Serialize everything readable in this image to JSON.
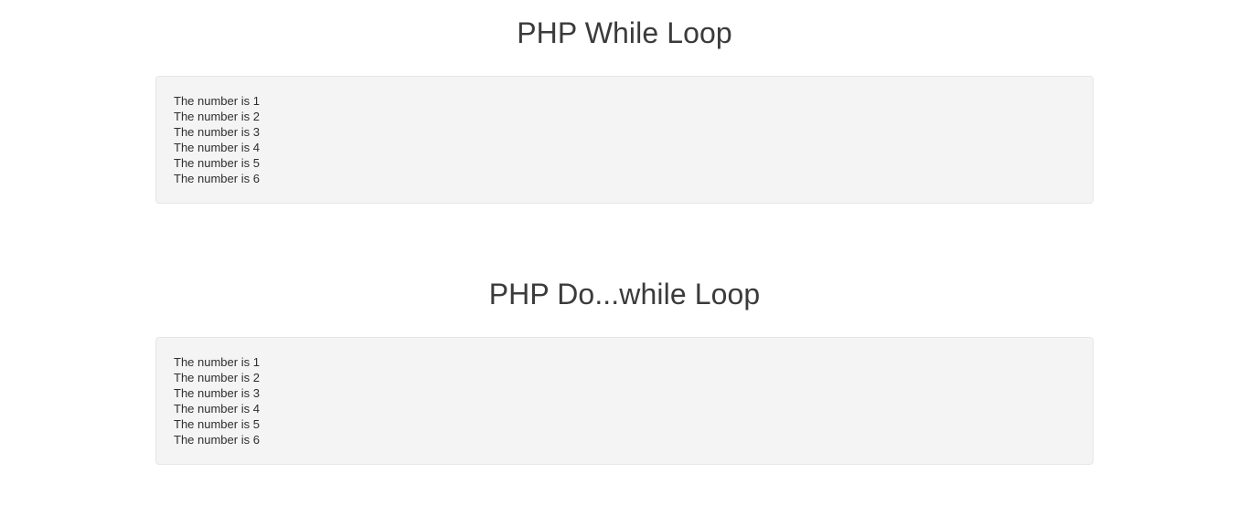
{
  "page": {
    "background_color": "#ffffff",
    "text_color": "#2e2e2e",
    "heading_color": "#3b3b3b",
    "box_background_color": "#f4f4f4",
    "box_border_color": "#e6e6e6"
  },
  "sections": [
    {
      "id": "while",
      "heading": "PHP While Loop",
      "output_lines": [
        "The number is 1",
        "The number is 2",
        "The number is 3",
        "The number is 4",
        "The number is 5",
        "The number is 6"
      ]
    },
    {
      "id": "dowhile",
      "heading": "PHP Do...while Loop",
      "output_lines": [
        "The number is 1",
        "The number is 2",
        "The number is 3",
        "The number is 4",
        "The number is 5",
        "The number is 6"
      ]
    }
  ]
}
